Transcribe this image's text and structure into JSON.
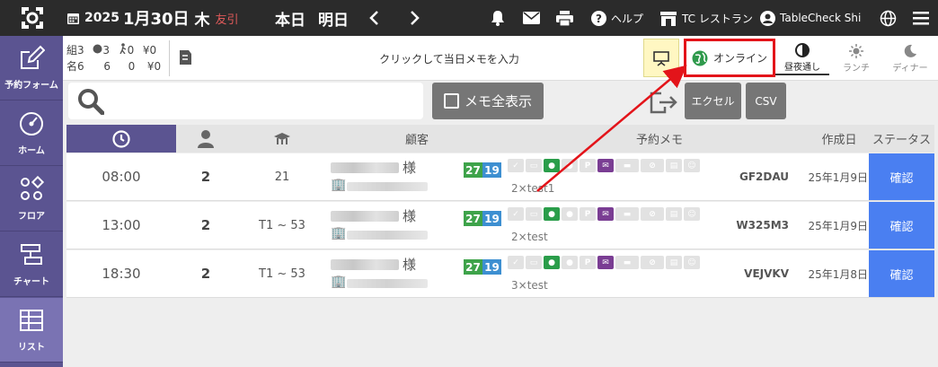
{
  "topbar": {
    "year": "2025",
    "monthday": "1月30日",
    "weekday": "木",
    "rokuyo": "友引",
    "today": "本日",
    "tomorrow": "明日",
    "help": "ヘルプ",
    "store": "TC レストラン",
    "user": "TableCheck Shi"
  },
  "sidebar": {
    "items": [
      {
        "label": "予約フォーム",
        "icon": "edit-icon"
      },
      {
        "label": "ホーム",
        "icon": "gauge-icon"
      },
      {
        "label": "フロア",
        "icon": "floor-icon"
      },
      {
        "label": "チャート",
        "icon": "chart-icon"
      },
      {
        "label": "リスト",
        "icon": "list-icon"
      }
    ]
  },
  "counts": {
    "row1": {
      "label": "組",
      "a": "3",
      "b": "3",
      "c": "0",
      "d": "¥0"
    },
    "row2": {
      "label": "名",
      "a": "6",
      "b": "6",
      "c": "0",
      "d": "¥0"
    }
  },
  "memo_placeholder": "クリックして当日メモを入力",
  "online_label": "オンライン",
  "modes": {
    "all": "昼夜通し",
    "lunch": "ランチ",
    "dinner": "ディナー"
  },
  "toolbar": {
    "memo_all": "メモ全表示",
    "excel": "エクセル",
    "csv": "CSV"
  },
  "table": {
    "headers": {
      "customer": "顧客",
      "memo": "予約メモ",
      "created": "作成日",
      "status": "ステータス"
    },
    "rows": [
      {
        "time": "08:00",
        "people": "2",
        "table": "21",
        "honorific": "様",
        "num1": "27",
        "num2": "19",
        "memo": "2×test1",
        "code": "GF2DAU",
        "date": "25年1月9日",
        "status": "確認"
      },
      {
        "time": "13:00",
        "people": "2",
        "table": "T1 ~ 53",
        "honorific": "様",
        "num1": "27",
        "num2": "19",
        "memo": "2×test",
        "code": "W325M3",
        "date": "25年1月9日",
        "status": "確認"
      },
      {
        "time": "18:30",
        "people": "2",
        "table": "T1 ~ 53",
        "honorific": "様",
        "num1": "27",
        "num2": "19",
        "memo": "3×test",
        "code": "VEJVKV",
        "date": "25年1月8日",
        "status": "確認"
      }
    ]
  },
  "colors": {
    "sidebar": "#5b5491",
    "accent_blue": "#4a7ff1",
    "highlight": "#e3141a",
    "topbar": "#2b2b2b"
  }
}
